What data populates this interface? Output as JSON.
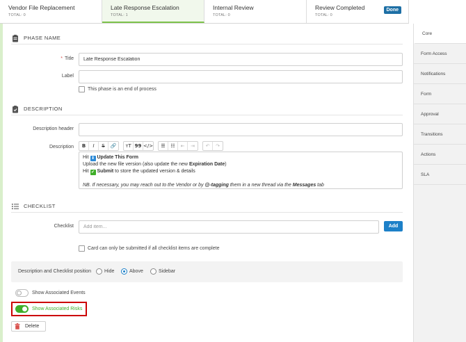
{
  "phase_tabs": [
    {
      "name": "Vendor File Replacement",
      "total": "TOTAL: 0"
    },
    {
      "name": "Late Response Escalation",
      "total": "TOTAL: 1"
    },
    {
      "name": "Internal Review",
      "total": "TOTAL: 0"
    },
    {
      "name": "Review Completed",
      "total": "TOTAL: 0",
      "badge": "Done"
    }
  ],
  "side_nav": [
    "Core",
    "Form Access",
    "Notifications",
    "Form",
    "Approval",
    "Transitions",
    "Actions",
    "SLA"
  ],
  "phase_name": {
    "section_title": "PHASE NAME",
    "title_label": "Title",
    "title_required": "*",
    "title_value": "Late Response Escalation",
    "label_label": "Label",
    "label_value": "",
    "end_of_process_label": "This phase is an end of process"
  },
  "description": {
    "section_title": "DESCRIPTION",
    "header_label": "Description header",
    "header_value": "",
    "body_label": "Description",
    "toolbar": {
      "bold": "B",
      "italic": "I",
      "strike": "S",
      "link": "🔗",
      "heading": "ᴛT",
      "quote": "99",
      "code": "</>",
      "bullet_list": "☰",
      "ordered_list": "☷",
      "outdent": "⇤",
      "indent": "⇥",
      "undo": "↶",
      "redo": "↷"
    },
    "lines": {
      "l1_pre": "Hit ",
      "l1_bold": "Update This Form",
      "l2_pre": "Upload the new file version (also update the new ",
      "l2_bold": "Expiration Date",
      "l2_post": ")",
      "l3_pre": "Hit ",
      "l3_bold": "Submit",
      "l3_post": " to store the updated version & details",
      "note_pre": "NB. If necessary, you may reach out to the Vendor or by ",
      "note_bold1": "@-tagging",
      "note_mid": " them in a new thread via the ",
      "note_bold2": "Messages",
      "note_post": " tab"
    }
  },
  "checklist": {
    "section_title": "CHECKLIST",
    "label": "Checklist",
    "placeholder": "Add item...",
    "add_label": "Add",
    "complete_label": "Card can only be submitted if all checklist items are complete"
  },
  "position": {
    "label": "Description and Checklist position",
    "options": [
      "Hide",
      "Above",
      "Sidebar"
    ],
    "selected": "Above"
  },
  "toggles": {
    "events_label": "Show Associated Events",
    "events_on": false,
    "risks_label": "Show Associated Risks",
    "risks_on": true
  },
  "delete_label": "Delete",
  "colors": {
    "accent_blue": "#1d80c8",
    "done_badge": "#1d6fa5",
    "toggle_on": "#3fae29",
    "highlight_border": "#cc0000",
    "active_tab_bg": "#f1f8ec",
    "required": "#d9534f"
  }
}
